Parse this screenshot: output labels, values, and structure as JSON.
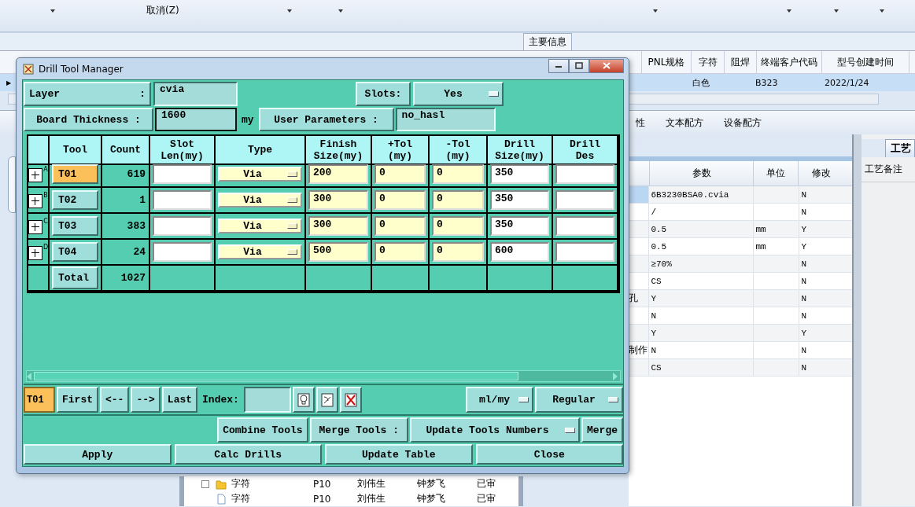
{
  "app": {
    "toolbar_text": "取消(Z)",
    "section_label": "主要信息",
    "grid_columns": [
      "PNL规格",
      "字符",
      "阻焊",
      "终端客户代码",
      "型号创建时间"
    ],
    "grid_row": {
      "selected": true,
      "row_marker": "▶",
      "cells": [
        "白色",
        "B323",
        "2022/1/24"
      ]
    },
    "tabs": [
      "性",
      "文本配方",
      "设备配方"
    ],
    "params": {
      "columns": [
        "参数",
        "单位",
        "修改"
      ],
      "rows": [
        {
          "param": "6B3230BSA0.cvia",
          "modified": "N",
          "selected": true
        },
        {
          "param": "/",
          "modified": "N",
          "selected": false
        },
        {
          "param": "0.5",
          "unit": "mm",
          "modified": "Y",
          "selected": false
        },
        {
          "param": "0.5",
          "unit": "mm",
          "modified": "Y",
          "selected": false
        },
        {
          "param": "≥70%",
          "modified": "N",
          "selected": false
        },
        {
          "param": "CS",
          "modified": "N",
          "selected": false
        },
        {
          "label": "孔",
          "param": "Y",
          "modified": "N",
          "selected": false
        },
        {
          "param": "N",
          "modified": "N",
          "selected": false
        },
        {
          "param": "Y",
          "modified": "Y",
          "selected": false
        },
        {
          "label": "制作",
          "param": "N",
          "modified": "N",
          "selected": false
        },
        {
          "param": "CS",
          "modified": "N",
          "selected": false
        }
      ]
    },
    "side_panel": {
      "tab": "工艺",
      "label": "工艺备注"
    },
    "tree_rows": [
      {
        "name": "字符",
        "code": "P10",
        "author": "刘伟生",
        "reviewer": "钟梦飞",
        "status": "已审",
        "expanded": true
      },
      {
        "name": "字符",
        "code": "P10",
        "author": "刘伟生",
        "reviewer": "钟梦飞",
        "status": "已审"
      }
    ]
  },
  "dialog": {
    "title": "Drill Tool Manager",
    "layer": {
      "label": "Layer",
      "colon": ":",
      "value": "cvia"
    },
    "slots": {
      "label": "Slots:",
      "value": "Yes"
    },
    "board_thickness": {
      "label": "Board Thickness :",
      "value": "1600",
      "unit": "my"
    },
    "user_parameters": {
      "label": "User Parameters :",
      "value": "no_hasl"
    },
    "table": {
      "columns": [
        [
          "Tool"
        ],
        [
          "Count"
        ],
        [
          "Slot",
          "Len(my)"
        ],
        [
          "Type"
        ],
        [
          "Finish",
          "Size(my)"
        ],
        [
          "+Tol",
          "(my)"
        ],
        [
          "-Tol",
          "(my)"
        ],
        [
          "Drill",
          "Size(my)"
        ],
        [
          "Drill",
          "Des"
        ]
      ],
      "rows": [
        {
          "mark": "A",
          "tool": "T01",
          "selected": true,
          "count": "619",
          "type": "Via",
          "finish": "200",
          "plus_tol": "0",
          "minus_tol": "0",
          "drill_size": "350"
        },
        {
          "mark": "B",
          "tool": "T02",
          "selected": false,
          "count": "1",
          "type": "Via",
          "finish": "300",
          "plus_tol": "0",
          "minus_tol": "0",
          "drill_size": "350"
        },
        {
          "mark": "C",
          "tool": "T03",
          "selected": false,
          "count": "383",
          "type": "Via",
          "finish": "300",
          "plus_tol": "0",
          "minus_tol": "0",
          "drill_size": "350"
        },
        {
          "mark": "D",
          "tool": "T04",
          "selected": false,
          "count": "24",
          "type": "Via",
          "finish": "500",
          "plus_tol": "0",
          "minus_tol": "0",
          "drill_size": "600"
        }
      ],
      "total": {
        "label": "Total",
        "count": "1027"
      }
    },
    "nav": {
      "current": "T01",
      "buttons": [
        "First",
        "<--",
        "-->",
        "Last"
      ],
      "index_label": "Index:",
      "units": "ml/my",
      "mode": "Regular"
    },
    "merge": {
      "combine": "Combine Tools",
      "label": "Merge Tools :",
      "option": "Update Tools Numbers",
      "merge": "Merge"
    },
    "actions": [
      "Apply",
      "Calc Drills",
      "Update Table",
      "Close"
    ]
  }
}
